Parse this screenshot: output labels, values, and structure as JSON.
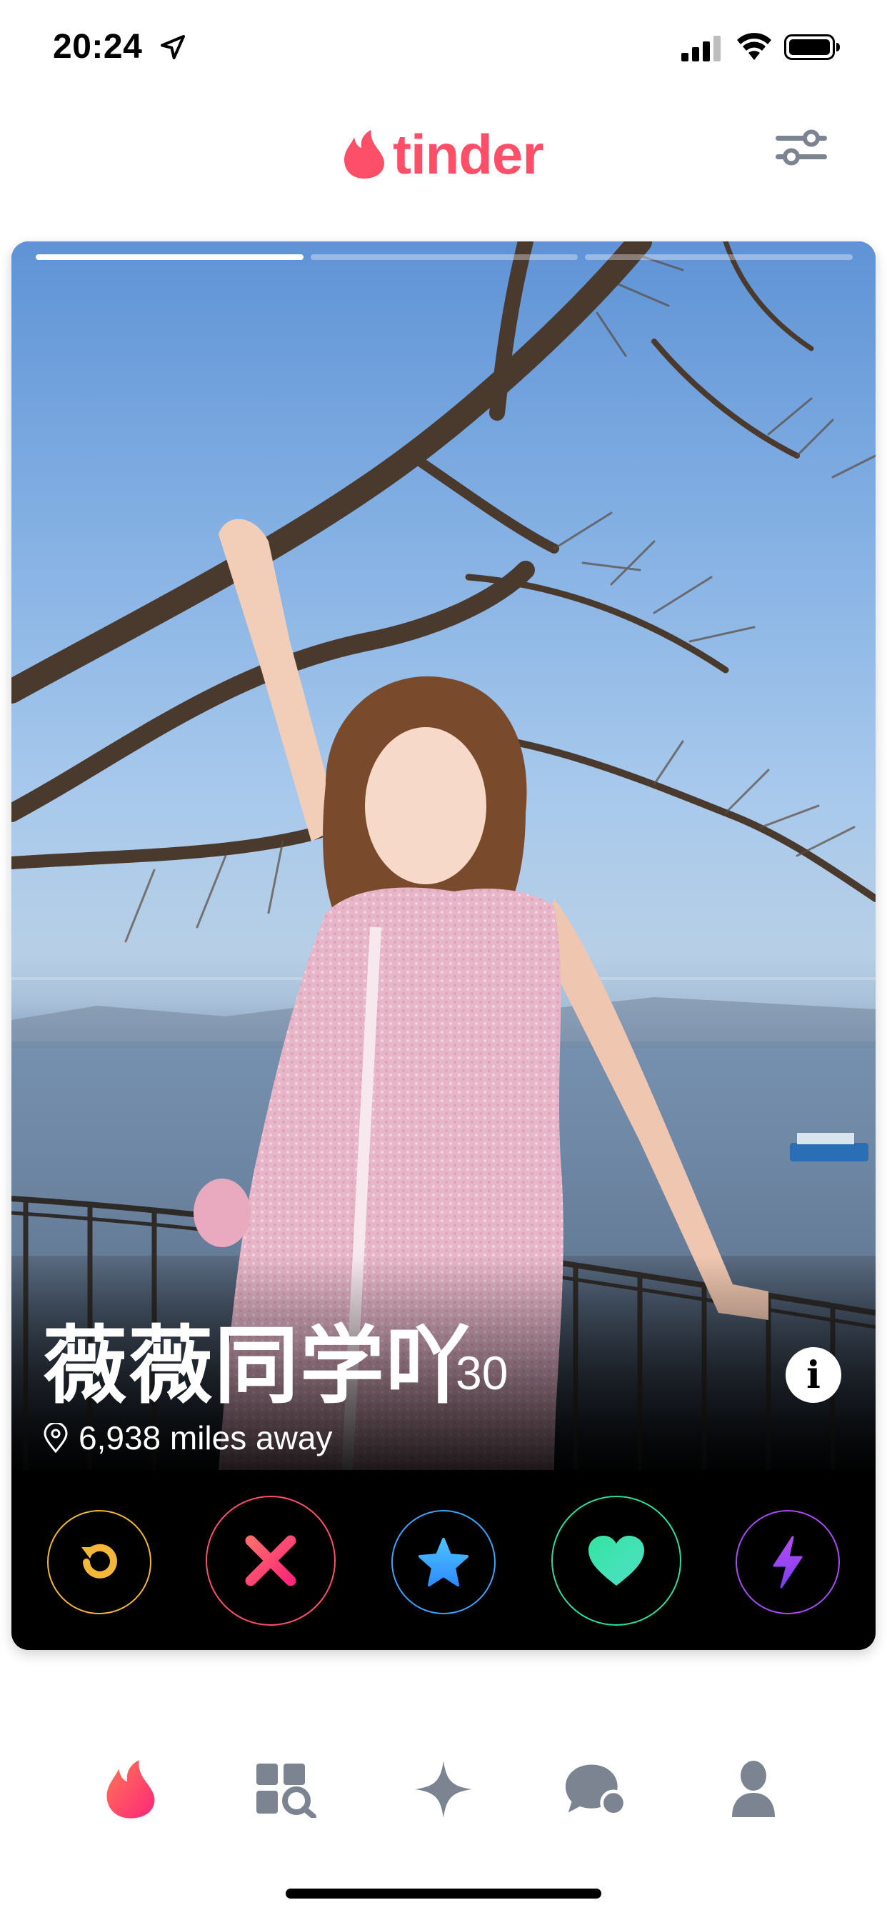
{
  "status_bar": {
    "time": "20:24",
    "icons": [
      "location-arrow-icon",
      "cellular-signal-icon",
      "wifi-icon",
      "battery-icon"
    ]
  },
  "header": {
    "logo_text": "tinder",
    "brand_color": "#fd5068",
    "settings_icon": "sliders-icon"
  },
  "card": {
    "photo_count": 3,
    "active_photo": 1,
    "profile": {
      "name": "薇薇同学吖",
      "age": "30",
      "distance": "6,938 miles away"
    },
    "info_icon": "info-icon"
  },
  "actions": [
    {
      "name": "rewind-button",
      "icon": "rewind-icon",
      "color": "#f3b839"
    },
    {
      "name": "nope-button",
      "icon": "close-icon",
      "color": "#fd5068"
    },
    {
      "name": "super-like-button",
      "icon": "star-icon",
      "color": "#3ca4ff"
    },
    {
      "name": "like-button",
      "icon": "heart-icon",
      "color": "#2edb9a"
    },
    {
      "name": "boost-button",
      "icon": "lightning-icon",
      "color": "#a54cf2"
    }
  ],
  "bottom_nav": [
    {
      "name": "nav-home",
      "icon": "flame-icon",
      "active": true
    },
    {
      "name": "nav-explore",
      "icon": "explore-icon",
      "active": false
    },
    {
      "name": "nav-gold",
      "icon": "sparkle-icon",
      "active": false
    },
    {
      "name": "nav-messages",
      "icon": "chat-icon",
      "active": false
    },
    {
      "name": "nav-profile",
      "icon": "person-icon",
      "active": false
    }
  ]
}
